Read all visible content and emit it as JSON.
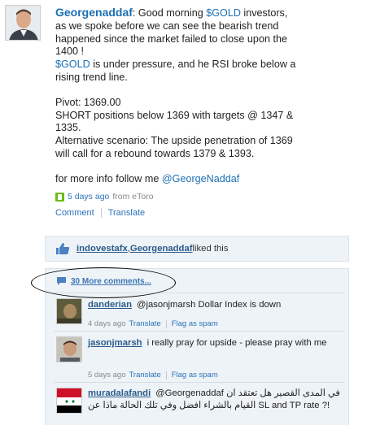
{
  "post": {
    "author": "Georgenaddaf",
    "sep": ": ",
    "text_1a": "Good morning ",
    "cashtag_1": "$GOLD",
    "text_1b": " investors, as we spoke before we can see the bearish trend happened since the market failed to close upon the 1400 !",
    "cashtag_2": "$GOLD",
    "text_2": " is under pressure, and he RSI broke below a rising trend line.",
    "pivot": "Pivot: 1369.00",
    "short": "SHORT positions below 1369 with targets @ 1347 & 1335.",
    "alt": "Alternative scenario: The upside penetration of 1369 will call for a rebound towards 1379 & 1393.",
    "more_info": "for more info follow me ",
    "mention": "@GeorgeNaddaf",
    "time": "5 days ago",
    "source": "from eToro",
    "comment_label": "Comment",
    "translate_label": "Translate"
  },
  "likes": {
    "user1": "indovestafx",
    "sep": ", ",
    "user2": "Georgenaddaf",
    "suffix": " liked this"
  },
  "more_comments": "30 More comments...",
  "comments": [
    {
      "user": "danderian",
      "text": "@jasonjmarsh Dollar Index is down",
      "time": "4 days ago",
      "translate": "Translate",
      "flag": "Flag as spam"
    },
    {
      "user": "jasonjmarsh",
      "text": "i really pray for upside - please pray with me",
      "time": "5 days ago",
      "translate": "Translate",
      "flag": "Flag as spam"
    },
    {
      "user": "muradalafandi",
      "text": "@Georgenaddaf في المدى القصير هل تعتقد ان القيام بالشراء افضل وفي تلك الحالة ماذا عن SL and TP rate ?!"
    }
  ],
  "colors": {
    "link": "#1a6fb5",
    "panel_bg": "#eef3f7",
    "etoro_green": "#6dbb1d"
  }
}
